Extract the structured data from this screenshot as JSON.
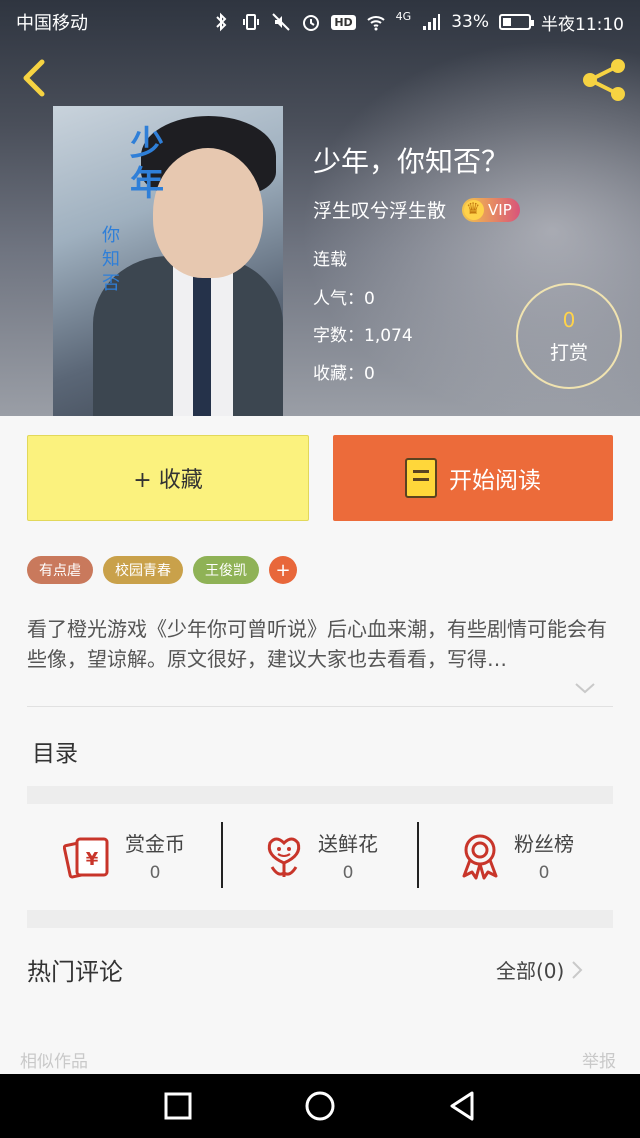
{
  "status_bar": {
    "carrier": "中国移动",
    "battery_percent": "33%",
    "time": "半夜11:10",
    "network": "4G",
    "hd_label": "HD",
    "battery_level": 0.33
  },
  "book": {
    "title": "少年，你知否？",
    "author": "浮生叹兮浮生散",
    "vip_label": "VIP",
    "status": "连载",
    "popularity": "人气：0",
    "word_count": "字数：1,074",
    "favorites": "收藏：0",
    "cover_title": "少年",
    "cover_subtitle": "你知否"
  },
  "reward": {
    "count": "0",
    "label": "打赏"
  },
  "actions": {
    "collect_label": "+ 收藏",
    "read_label": "开始阅读"
  },
  "tags": [
    {
      "label": "有点虐",
      "color": "#c9795c"
    },
    {
      "label": "校园青春",
      "color": "#c9a14a"
    },
    {
      "label": "王俊凯",
      "color": "#8fb256"
    }
  ],
  "tag_add_color": "#e8673a",
  "description": "看了橙光游戏《少年你可曾听说》后心血来潮，有些剧情可能会有些像，望谅解。原文很好，建议大家也去看看，写得…",
  "toc_label": "目录",
  "stats": [
    {
      "label": "赏金币",
      "value": "0",
      "icon": "gold-coin-icon"
    },
    {
      "label": "送鲜花",
      "value": "0",
      "icon": "flower-icon"
    },
    {
      "label": "粉丝榜",
      "value": "0",
      "icon": "ribbon-medal-icon"
    }
  ],
  "hot_comments": {
    "title": "热门评论",
    "all_label": "全部(0)"
  },
  "footer": {
    "similar_label": "相似作品",
    "report_label": "举报"
  },
  "colors": {
    "accent_yellow": "#fbf27e",
    "accent_orange": "#ec6b3a",
    "icon_red": "#c8352a",
    "reward_gold": "#ffd34a"
  }
}
